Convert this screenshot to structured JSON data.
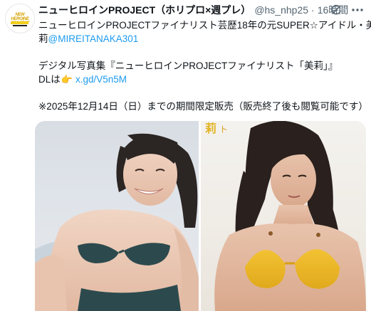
{
  "tweet": {
    "display_name": "ニューヒロインPROJECT（ホリプロ×週プレ）",
    "handle": "@hs_nhp25",
    "separator": "·",
    "time": "16時間",
    "text_line1": "ニューヒロインPROJECTファイナリスト芸歴18年の元SUPER☆アイドル・美",
    "text_line2_prefix": "莉",
    "mention": "@MIREITANAKA301",
    "text_line3": "デジタル写真集『ニューヒロインPROJECTファイナリスト「美莉」』",
    "text_line4_prefix": "DLは",
    "pointer_emoji": "👉",
    "link": "x.gd/V5n5M",
    "text_line5": "※2025年12月14日（日）までの期間限定販売（販売終了後も閲覧可能です）"
  },
  "avatar": {
    "logo_text": "NEW HEROINE PROJECT"
  },
  "media": {
    "right_photo_caption_chars": [
      "莉",
      "ト"
    ]
  },
  "icons": {
    "retweet": "grok-icon",
    "more": "more-icon"
  },
  "colors": {
    "link": "#1d9bf0",
    "secondary": "#536471",
    "text": "#0f1419"
  }
}
